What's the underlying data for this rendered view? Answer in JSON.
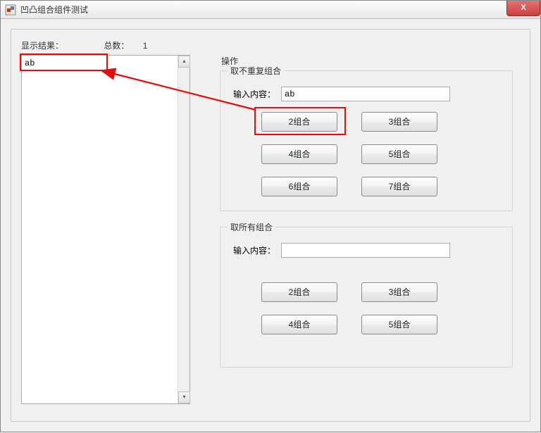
{
  "window": {
    "title": "凹凸组合组件测试",
    "close": "X"
  },
  "left": {
    "result_label": "显示结果：",
    "count_label": "总数：",
    "count_value": "1",
    "result_text": "ab"
  },
  "ops": {
    "title": "操作",
    "group1": {
      "title": "取不重复组合",
      "input_label": "输入内容：",
      "input_value": "ab",
      "buttons": [
        "2组合",
        "3组合",
        "4组合",
        "5组合",
        "6组合",
        "7组合"
      ]
    },
    "group2": {
      "title": "取所有组合",
      "input_label": "输入内容：",
      "input_value": "",
      "buttons": [
        "2组合",
        "3组合",
        "4组合",
        "5组合"
      ]
    }
  }
}
